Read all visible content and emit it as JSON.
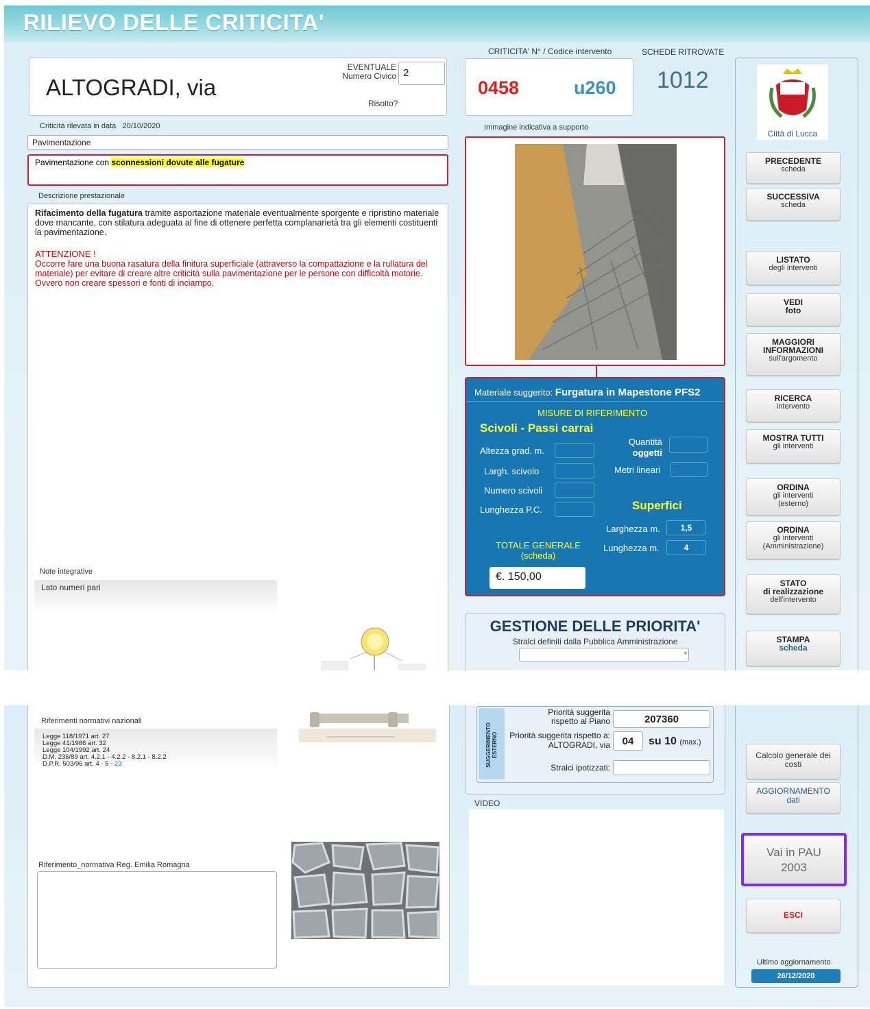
{
  "header": {
    "title": "RILIEVO DELLE CRITICITA'"
  },
  "address": {
    "street": "ALTOGRADI, via",
    "civico_label_1": "EVENTUALE",
    "civico_label_2": "Numero Civico",
    "civico_value": "2",
    "risolto": "Risolto?"
  },
  "codes": {
    "header": "CRITICITA' N° / Codice intervento",
    "critic_no": "0458",
    "code": "u260",
    "schede_header": "SCHEDE RITROVATE",
    "schede_count": "1012"
  },
  "detection": {
    "label": "Criticità rilevata in data",
    "date": "20/10/2020"
  },
  "category": "Pavimentazione",
  "problem": {
    "prefix": "Pavimentazione con ",
    "highlight": "sconnessioni dovute alle fugature"
  },
  "description": {
    "label": "Descrizione  prestazionale",
    "bold": "Rifacimento della fugatura",
    "text": " tramite asportazione materiale eventualmente sporgente e ripristino materiale dove mancante, con stilatura adeguata al fine di ottenere perfetta complanarietà tra gli elementi costituenti la pavimentazione.",
    "warn_title": "ATTENZIONE !",
    "warn_text": "Occorre fare una buona rasatura della finitura superficiale (attraverso la compattazione e la rullatura del materiale) per evitare di creare altre criticità sulla pavimentazione per le persone con difficoltà motorie. Ovvero non creare spessori e fonti di inciampo."
  },
  "notes": {
    "label": "Note integrative",
    "value": "Lato numeri pari"
  },
  "image_label": "Immagine indicativa a supporto",
  "material": {
    "label": "Materiale suggerito:",
    "value": "Furgatura in Mapestone PFS2",
    "misure": "MISURE DI RIFERIMENTO",
    "scivoli": "Scivoli - Passi carrai",
    "altezza": "Altezza grad. m.",
    "largh": "Largh.  scivolo",
    "numero": "Numero scivoli",
    "lung_pc": "Lunghezza P.C.",
    "quantita1": "Quantità",
    "quantita2": "oggetti",
    "metri": "Metri lineari",
    "superfici": "Superfici",
    "larghezza": "Larghezza m.",
    "larghezza_val": "1,5",
    "lunghezza": "Lunghezza m.",
    "lunghezza_val": "4",
    "totale1": "TOTALE GENERALE",
    "totale2": "(scheda)",
    "totale_val": "€.  150,00"
  },
  "priorita": {
    "title": "GESTIONE DELLE PRIORITA'",
    "subtitle": "Stralci definiti dalla Pubblica Amministrazione",
    "vert": "SUGGERIMENTO ESTERNO",
    "p1a": "Priorità suggerita",
    "p1b": "rispetto al Piano",
    "p1_val": "207360",
    "p2a": "Priorità suggerita rispetto a:",
    "p2b": "ALTOGRADI, via",
    "p2_val": "04",
    "su": "su 10",
    "max": "(max.)",
    "stralci": "Stralci ipotizzati:"
  },
  "video": "VIDEO",
  "rif_naz": {
    "label": "Riferimenti normativi nazionali",
    "lines": [
      "Legge 118/1971 art. 27",
      "Legge 41/1986 art. 32",
      "Legge 104/1992 art. 24",
      "D.M. 236/89 art. 4.2.1 - 4.2.2 - 8.2.1 - 8.2.2"
    ],
    "dpr": "D.P.R. 503/96 art. 4 - 5 - ",
    "dpr_link": "23"
  },
  "rif_reg": "Riferimento_normativa Reg. Emilia Romagna",
  "logo": {
    "caption": "Città di Lucca"
  },
  "buttons": [
    {
      "t": "PRECEDENTE",
      "s": "scheda"
    },
    {
      "t": "SUCCESSIVA",
      "s": "scheda"
    },
    {
      "t": "LISTATO",
      "s": "degli interventi"
    },
    {
      "t": "VEDI",
      "s": "foto"
    },
    {
      "t": "MAGGIORI",
      "t2": "INFORMAZIONI",
      "s": "sull'argomento"
    },
    {
      "t": "RICERCA",
      "s": "intervento"
    },
    {
      "t": "MOSTRA TUTTI",
      "s": "gli interventi"
    },
    {
      "t": "ORDINA",
      "s": "gli interventi",
      "s2": "(esterno)"
    },
    {
      "t": "ORDINA",
      "s": "gli interventi",
      "s2": "(Amministrazione)"
    },
    {
      "t": "STATO",
      "t2": "di realizzazione",
      "s": "dell'intervento"
    },
    {
      "t": "STAMPA",
      "t2": "scheda"
    }
  ],
  "calc": {
    "l1": "Calcolo generale dei",
    "l2": "costi"
  },
  "agg": {
    "l1": "AGGIORNAMENTO",
    "l2": "dati"
  },
  "pau": {
    "l1": "Vai in PAU",
    "l2": "2003"
  },
  "esci": "ESCI",
  "ultimo": {
    "label": "Ultimo aggiornamento",
    "date": "26/12/2020"
  },
  "colors": {
    "accent_red": "#c0262d",
    "panel_blue": "#1877b0",
    "highlight": "#ffff33",
    "pau_border": "#7b2ff0"
  }
}
